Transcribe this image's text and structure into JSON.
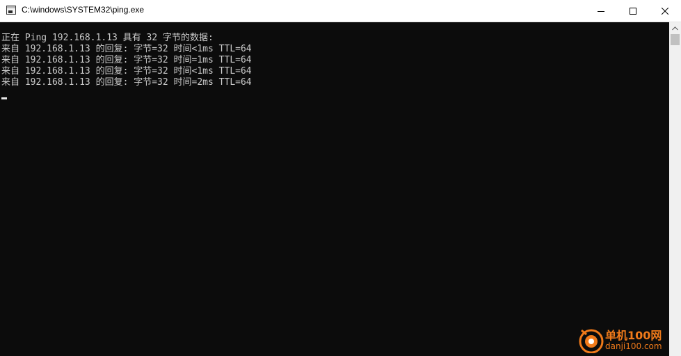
{
  "window": {
    "title": "C:\\windows\\SYSTEM32\\ping.exe",
    "icon": "console-app-icon",
    "controls": [
      "minimize-icon",
      "maximize-icon",
      "close-icon"
    ]
  },
  "console": {
    "lines": [
      "正在 Ping 192.168.1.13 具有 32 字节的数据:",
      "来自 192.168.1.13 的回复: 字节=32 时间<1ms TTL=64",
      "来自 192.168.1.13 的回复: 字节=32 时间=1ms TTL=64",
      "来自 192.168.1.13 的回复: 字节=32 时间<1ms TTL=64",
      "来自 192.168.1.13 的回复: 字节=32 时间=2ms TTL=64"
    ],
    "text_color": "#cccccc",
    "background": "#0c0c0c"
  },
  "watermark": {
    "title": "单机100网",
    "url": "danji100.com",
    "color": "#f07a1a"
  }
}
